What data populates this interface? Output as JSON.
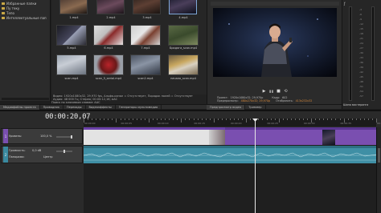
{
  "explorer": {
    "items": [
      {
        "label": "Избранные папки"
      },
      {
        "label": "Пу теку"
      },
      {
        "label": "Тепо"
      },
      {
        "label": "Интеллектуальные пап"
      }
    ]
  },
  "media": {
    "items": [
      {
        "caption": "1.mp4"
      },
      {
        "caption": "2.mp4"
      },
      {
        "caption": "3.mp4"
      },
      {
        "caption": "4.mp4"
      },
      {
        "caption": "5.mp4"
      },
      {
        "caption": "6.mp4"
      },
      {
        "caption": "7.mp4"
      },
      {
        "caption": "Бродяга_scan.mp4"
      },
      {
        "caption": "scan.mp4"
      },
      {
        "caption": "scan_5_serial.mp4"
      },
      {
        "caption": "scan2.mp4"
      },
      {
        "caption": "начало_scan.mp4"
      }
    ]
  },
  "file_info": {
    "line1": "Видео: 1920x1080x32, 29,970 fps, Альфа-канал = Отсутствует, Порядок полей = Отсутствует",
    "line2": "Аудио: 48 000 Гц; Стерео; 00:00:12,16; AAC",
    "line3": "Поиск по ключевым словам: AAC"
  },
  "left_tabs": [
    "Медиафайлы проекта",
    "Проводник",
    "Переходы",
    "Видеоэффекты",
    "Генераторы мультимедиа"
  ],
  "preview": {
    "project_label": "Проект:",
    "project_value": "1920x1080x32; 29,970p",
    "preview_label": "Предпросмотр:",
    "preview_value": "480x270x32; 29,970p",
    "frame_label": "Кадр:",
    "frame_value": "602",
    "display_label": "Отобразить:",
    "display_value": "413x232x32",
    "tabs": [
      "Предпросмотр видео",
      "Триммер"
    ],
    "transport": {
      "play": "▶",
      "pause": "❚❚",
      "stop": "■",
      "loop": "⟲"
    }
  },
  "meter": {
    "title": "Шина мастеринга",
    "ticks": [
      "-3",
      "-6",
      "-9",
      "-12",
      "-15",
      "-18",
      "-21",
      "-24",
      "-27",
      "-30",
      "-33",
      "-36",
      "-39",
      "-42",
      "-45",
      "-48",
      "-51",
      "-54",
      "-57"
    ]
  },
  "timeline": {
    "timecode": "00:00:20,07",
    "ruler_labels": [
      "00:00:00",
      "00:00:05",
      "00:00:10",
      "00:00:15",
      "00:00:20",
      "00:00:25",
      "00:00:30",
      "00:00:35",
      "00:00:40"
    ],
    "tracks": [
      {
        "number": "1",
        "name": "Уровень:",
        "value": "100,0 %",
        "level": 1.0
      },
      {
        "number": "2",
        "name": "Громкость:",
        "value": "0,0 dB",
        "pan_label": "Панорама:",
        "pan_value": "Центр",
        "level": 0.5
      }
    ]
  },
  "colors": {
    "video_track": "#7a4fb0",
    "audio_track": "#3a8aa0",
    "clip_bar": "#6a40a8",
    "accent": "#d9893a"
  }
}
